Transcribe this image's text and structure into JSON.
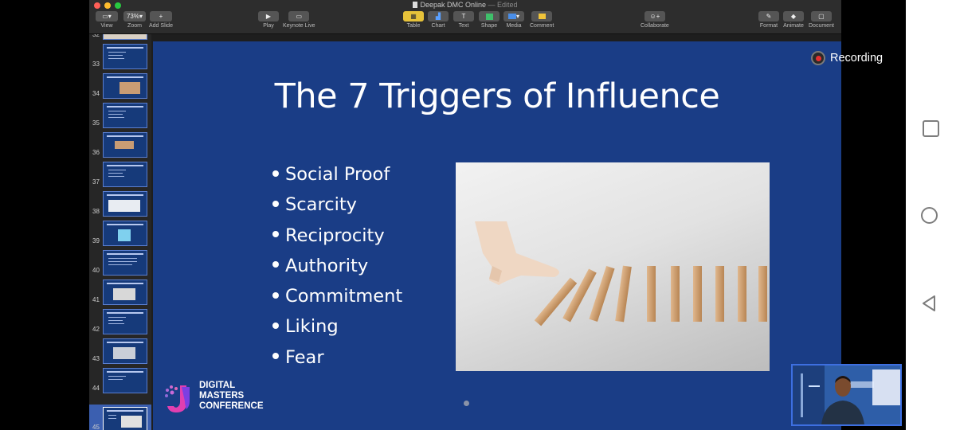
{
  "app": {
    "window_title": "Deepak DMC Online",
    "title_suffix": "— Edited",
    "toolbar": {
      "view": "View",
      "zoom_value": "73%",
      "zoom": "Zoom",
      "add_slide": "Add Slide",
      "play": "Play",
      "keynote_live": "Keynote Live",
      "table": "Table",
      "chart": "Chart",
      "text": "Text",
      "shape": "Shape",
      "media": "Media",
      "comment": "Comment",
      "collaborate": "Collaborate",
      "format": "Format",
      "animate": "Animate",
      "document": "Document"
    }
  },
  "navigator": {
    "slide_numbers": [
      "32",
      "33",
      "34",
      "35",
      "36",
      "37",
      "38",
      "39",
      "40",
      "41",
      "42",
      "43",
      "44",
      "45"
    ],
    "selected": "45"
  },
  "slide": {
    "title": "The 7 Triggers of Influence",
    "bullets": [
      "Social Proof",
      "Scarcity",
      "Reciprocity",
      "Authority",
      "Commitment",
      "Liking",
      "Fear"
    ],
    "logo_line1": "DIGITAL",
    "logo_line2": "MASTERS",
    "logo_line3": "CONFERENCE"
  },
  "recording": {
    "label": "Recording",
    "color": "#e53030"
  },
  "colors": {
    "slide_bg": "#1a3d86",
    "accent": "#3b5fb0"
  }
}
